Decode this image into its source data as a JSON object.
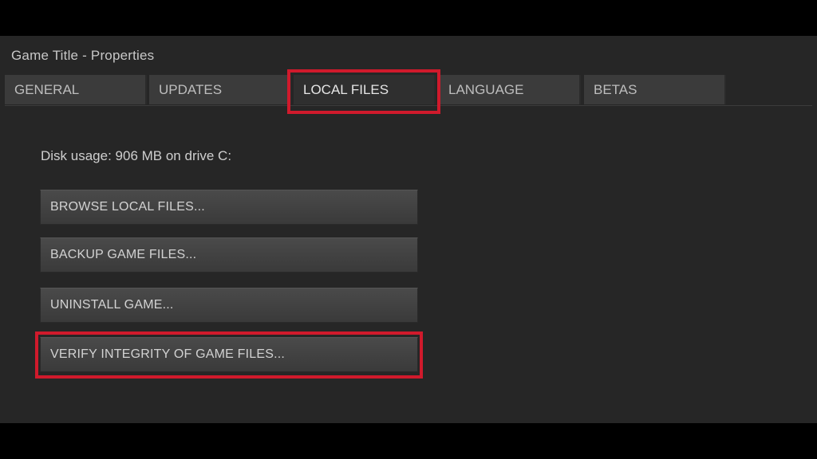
{
  "window": {
    "title": "Game Title - Properties"
  },
  "tabs": [
    {
      "label": "GENERAL",
      "active": false
    },
    {
      "label": "UPDATES",
      "active": false
    },
    {
      "label": "LOCAL FILES",
      "active": true
    },
    {
      "label": "LANGUAGE",
      "active": false
    },
    {
      "label": "BETAS",
      "active": false
    }
  ],
  "local_files": {
    "disk_usage": "Disk usage: 906 MB on drive C:",
    "buttons": {
      "browse": "BROWSE LOCAL FILES...",
      "backup": "BACKUP GAME FILES...",
      "uninstall": "UNINSTALL GAME...",
      "verify": "VERIFY INTEGRITY OF GAME FILES..."
    }
  },
  "colors": {
    "highlight": "#d01a2c",
    "window_bg": "#262626",
    "tab_bg": "#3b3b3b",
    "button_bg": "#424242",
    "text": "#cfcfcf"
  }
}
